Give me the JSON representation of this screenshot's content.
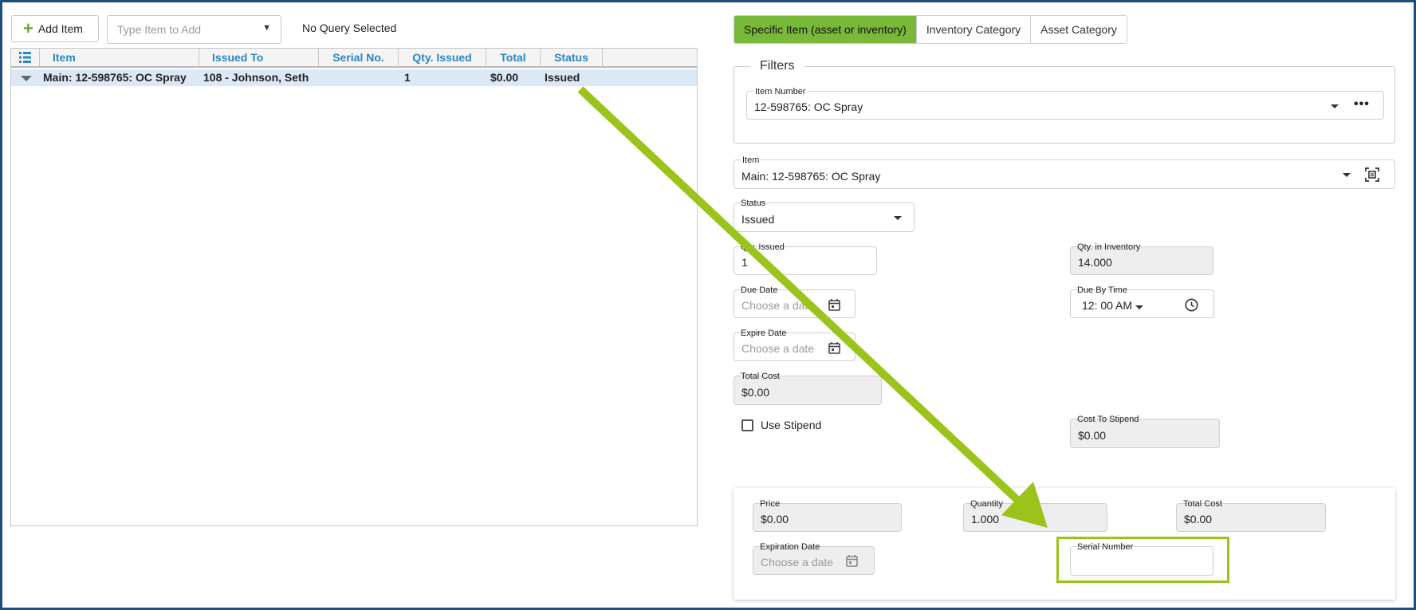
{
  "toolbar": {
    "add_item_label": "Add Item",
    "type_item_placeholder": "Type Item to Add",
    "query_status": "No Query Selected"
  },
  "grid": {
    "columns": [
      "Item",
      "Issued To",
      "Serial No.",
      "Qty. Issued",
      "Total",
      "Status"
    ],
    "rows": [
      {
        "item": "Main: 12-598765: OC Spray",
        "issued_to": "108 - Johnson, Seth",
        "serial_no": "",
        "qty_issued": "1",
        "total": "$0.00",
        "status": "Issued"
      }
    ]
  },
  "tabs": [
    {
      "label": "Specific Item (asset or inventory)",
      "active": true
    },
    {
      "label": "Inventory Category",
      "active": false
    },
    {
      "label": "Asset Category",
      "active": false
    }
  ],
  "filters": {
    "legend": "Filters",
    "item_number_label": "Item Number",
    "item_number_value": "12-598765: OC Spray"
  },
  "form": {
    "item_label": "Item",
    "item_value": "Main: 12-598765: OC Spray",
    "status_label": "Status",
    "status_value": "Issued",
    "qty_issued_label": "Qty. Issued",
    "qty_issued_value": "1",
    "qty_inventory_label": "Qty. in Inventory",
    "qty_inventory_value": "14.000",
    "due_date_label": "Due Date",
    "due_date_placeholder": "Choose a date",
    "due_by_time_label": "Due By Time",
    "due_by_time_value": "12: 00 AM",
    "expire_date_label": "Expire Date",
    "expire_date_placeholder": "Choose a date",
    "total_cost_label": "Total Cost",
    "total_cost_value": "$0.00",
    "use_stipend_label": "Use Stipend",
    "cost_to_stipend_label": "Cost To Stipend",
    "cost_to_stipend_value": "$0.00"
  },
  "card": {
    "price_label": "Price",
    "price_value": "$0.00",
    "quantity_label": "Quantity",
    "quantity_value": "1.000",
    "total_cost_label": "Total Cost",
    "total_cost_value": "$0.00",
    "expiration_date_label": "Expiration Date",
    "expiration_date_placeholder": "Choose a date",
    "serial_number_label": "Serial Number",
    "serial_number_value": ""
  },
  "colors": {
    "accent_green": "#78b93a",
    "arrow_green": "#9bc31c",
    "header_blue": "#2a86c4",
    "frame_blue": "#1f4e79"
  }
}
